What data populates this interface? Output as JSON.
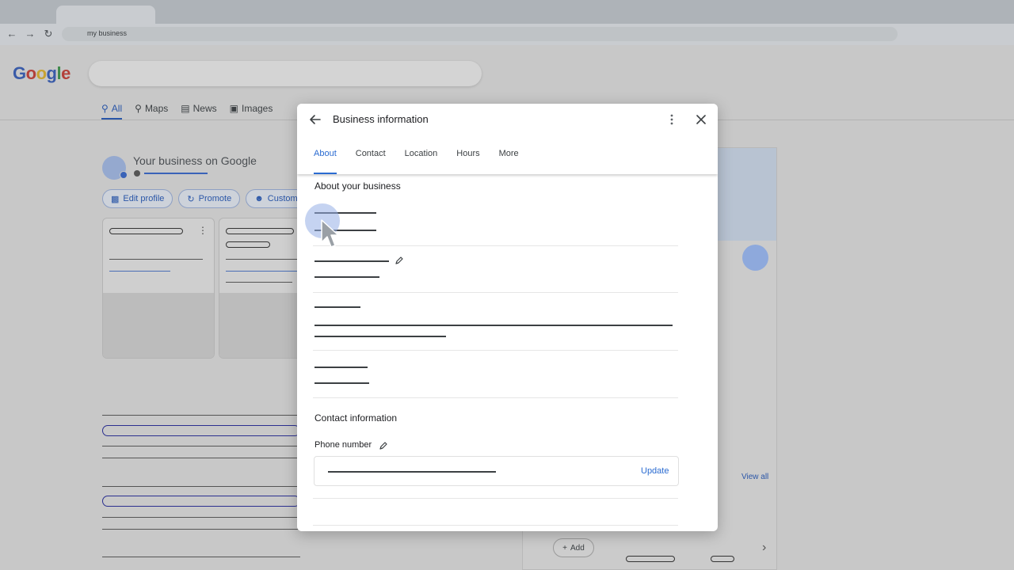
{
  "browser": {
    "address": "my business"
  },
  "search_page": {
    "logo_letters": [
      "G",
      "o",
      "o",
      "g",
      "l",
      "e"
    ],
    "tabs": [
      {
        "label": "All",
        "icon": "search-icon"
      },
      {
        "label": "Maps",
        "icon": "map-pin-icon"
      },
      {
        "label": "News",
        "icon": "news-icon"
      },
      {
        "label": "Images",
        "icon": "image-icon"
      }
    ],
    "business_title": "Your business on Google",
    "chips": [
      {
        "label": "Edit profile",
        "icon": "storefront-icon"
      },
      {
        "label": "Promote",
        "icon": "trend-icon"
      },
      {
        "label": "Customers",
        "icon": "people-icon"
      }
    ],
    "view_all": "View all",
    "add_label": "Add"
  },
  "modal": {
    "title": "Business information",
    "tabs": [
      {
        "label": "About",
        "active": true
      },
      {
        "label": "Contact",
        "active": false
      },
      {
        "label": "Location",
        "active": false
      },
      {
        "label": "Hours",
        "active": false
      },
      {
        "label": "More",
        "active": false
      }
    ],
    "about_section_title": "About your business",
    "contact_section_title": "Contact information",
    "phone_label": "Phone number",
    "update_label": "Update"
  },
  "colors": {
    "accent": "#2a6bd1",
    "overlay_dim": "#c8c8c8"
  }
}
